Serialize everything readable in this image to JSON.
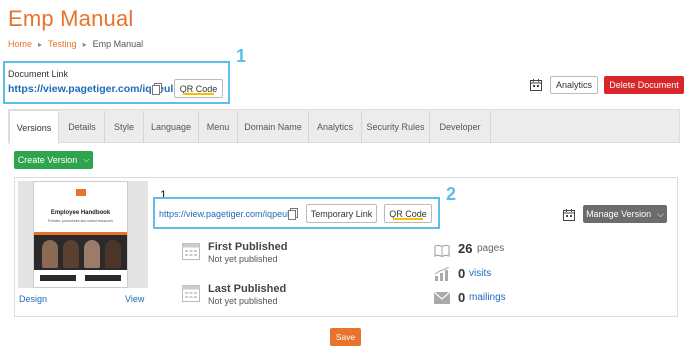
{
  "page": {
    "title": "Emp Manual"
  },
  "breadcrumb": {
    "items": [
      "Home",
      "Testing",
      "Emp Manual"
    ],
    "separator": "▸"
  },
  "document_link": {
    "label": "Document Link",
    "url": "https://view.pagetiger.com/iqpeul",
    "qr_label": "QR Code"
  },
  "annotations": {
    "first": "1",
    "second": "2"
  },
  "header_actions": {
    "analytics_label": "Analytics",
    "delete_label": "Delete Document"
  },
  "tabs": [
    {
      "label": "Versions",
      "active": true
    },
    {
      "label": "Details"
    },
    {
      "label": "Style"
    },
    {
      "label": "Language"
    },
    {
      "label": "Menu"
    },
    {
      "label": "Domain Name"
    },
    {
      "label": "Analytics"
    },
    {
      "label": "Security Rules"
    },
    {
      "label": "Developer"
    }
  ],
  "versions": {
    "create_label": "Create Version",
    "version": {
      "number": "1",
      "url": "https://view.pagetiger.com/iqpeul/1",
      "temporary_link_label": "Temporary Link",
      "qr_label": "QR Code",
      "manage_label": "Manage Version",
      "design_label": "Design",
      "view_label": "View",
      "thumbnail": {
        "brand": "PAGE TIGER",
        "title": "Employee Handbook",
        "subtitle": "Policies, procedures and useful resources"
      },
      "first_published": {
        "title": "First Published",
        "value": "Not yet published"
      },
      "last_published": {
        "title": "Last Published",
        "value": "Not yet published"
      },
      "stats": {
        "pages": {
          "count": "26",
          "label": "pages"
        },
        "visits": {
          "count": "0",
          "label": "visits"
        },
        "mailings": {
          "count": "0",
          "label": "mailings"
        }
      }
    }
  },
  "footer": {
    "save_label": "Save"
  },
  "colors": {
    "brand_orange": "#e8732c",
    "link_blue": "#1e6bb8",
    "highlight_box": "#5ebeea",
    "delete_red": "#d8262b",
    "create_green": "#2ea44f",
    "manage_gray": "#6c6c6c",
    "qr_underline": "#f2c200"
  }
}
